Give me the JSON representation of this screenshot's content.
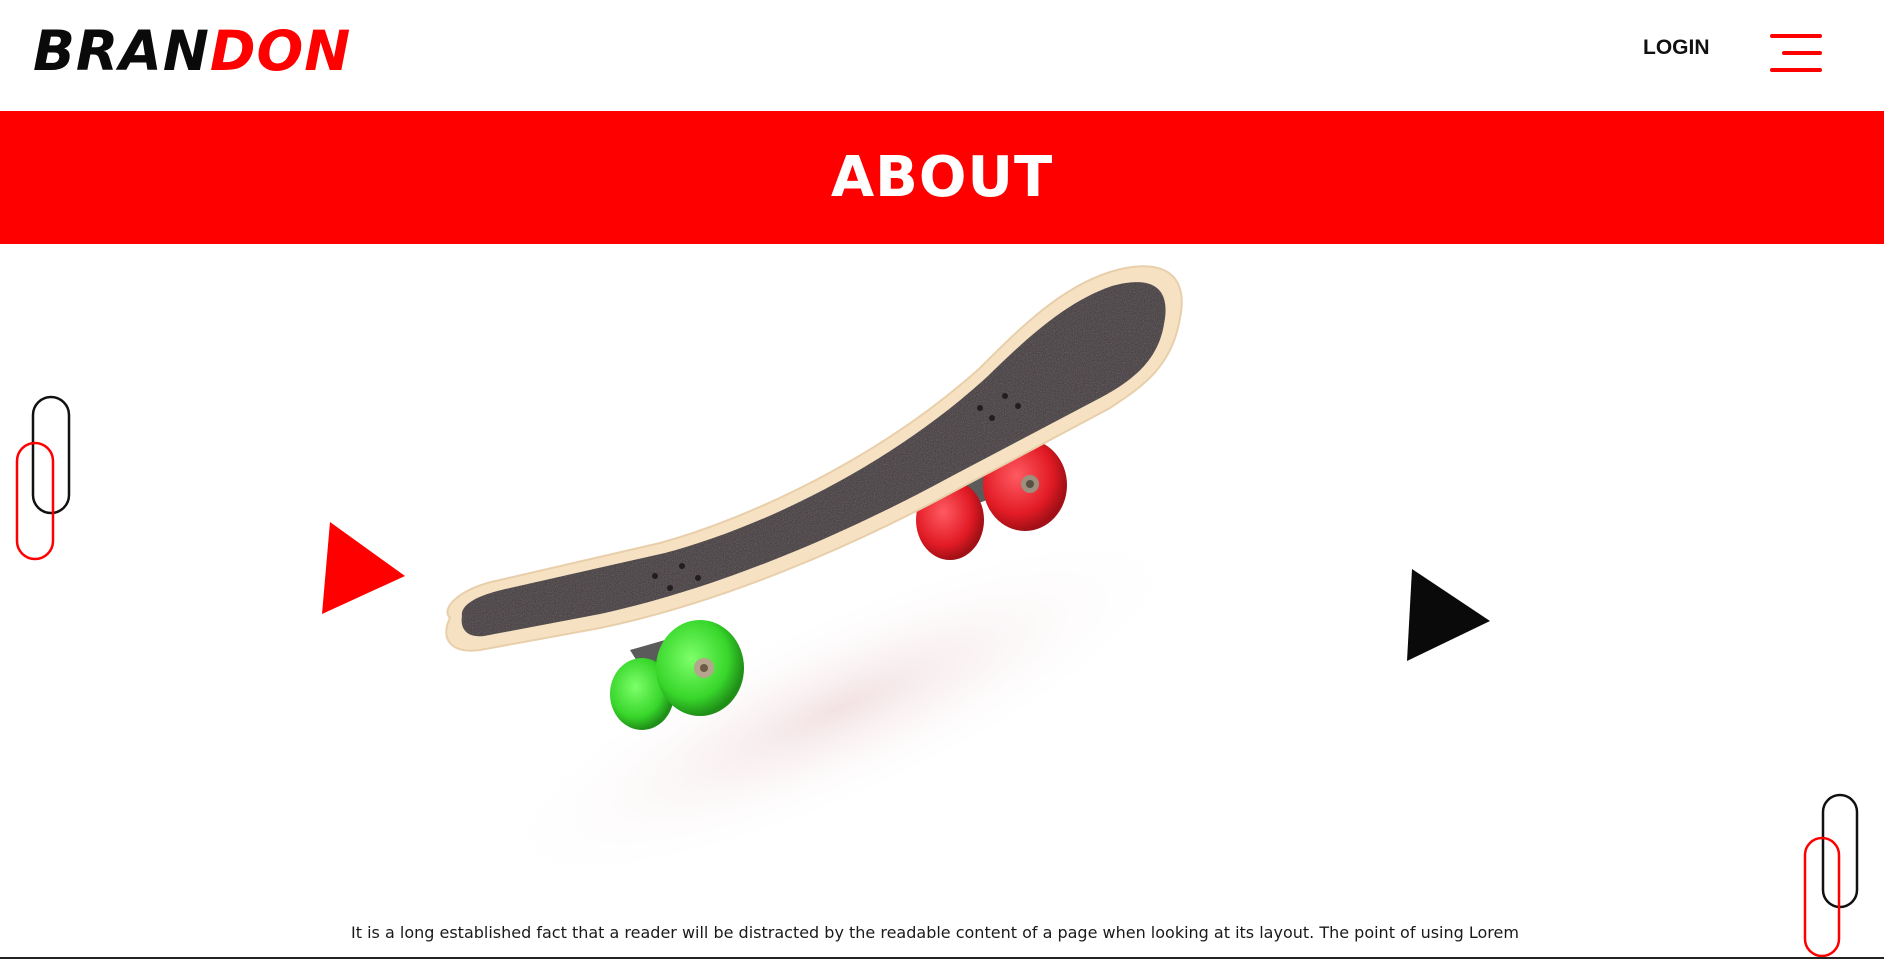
{
  "header": {
    "brand_part1": "BRAN",
    "brand_part2": "DON",
    "login_label": "LOGIN",
    "menu_icon": "hamburger-menu-icon"
  },
  "banner": {
    "title": "ABOUT"
  },
  "hero": {
    "image": "skateboard-image",
    "decorations": [
      "paperclip-icon",
      "triangle-play-icon-red",
      "triangle-play-icon-black",
      "paperclip-icon"
    ]
  },
  "about": {
    "text": "It is a long established fact that a reader will be distracted by the readable content of a page when looking at its layout. The point of using Lorem"
  },
  "colors": {
    "accent": "#ff0000",
    "text_dark": "#0a0a0a",
    "background": "#ffffff"
  }
}
